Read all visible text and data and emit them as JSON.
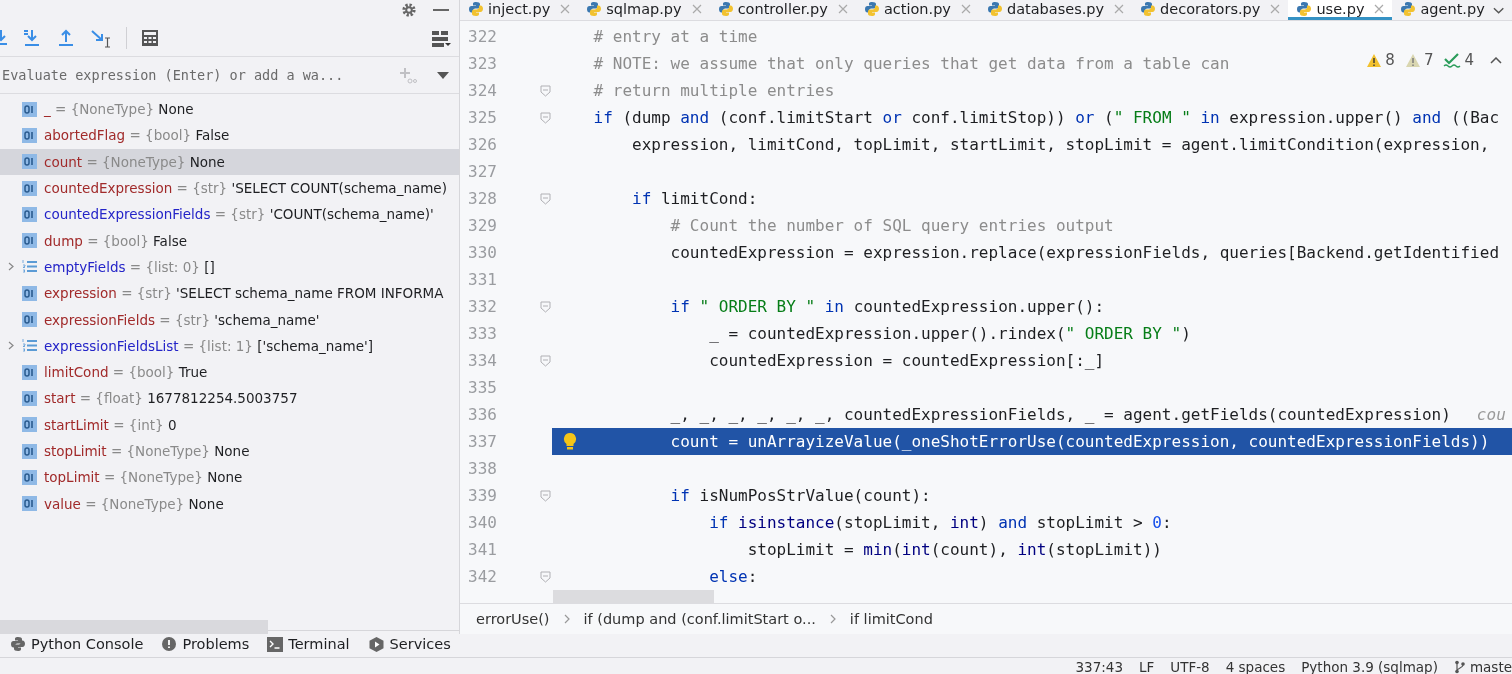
{
  "debugger": {
    "evaluate_field": {
      "placeholder": "Evaluate expression (Enter) or add a wa..."
    },
    "variables": [
      {
        "kind": "scalar",
        "name": "_",
        "annotation": "= {NoneType}",
        "value": "None",
        "color": "#a12a2a",
        "selected": false
      },
      {
        "kind": "scalar",
        "name": "abortedFlag",
        "annotation": "= {bool}",
        "value": "False",
        "color": "#a12a2a",
        "selected": false
      },
      {
        "kind": "scalar",
        "name": "count",
        "annotation": "= {NoneType}",
        "value": "None",
        "color": "#a12a2a",
        "selected": true
      },
      {
        "kind": "scalar",
        "name": "countedExpression",
        "annotation": "= {str}",
        "value": "'SELECT COUNT(schema_name)",
        "color": "#a12a2a",
        "selected": false
      },
      {
        "kind": "scalar",
        "name": "countedExpressionFields",
        "annotation": "= {str}",
        "value": "'COUNT(schema_name)'",
        "color": "#2424c8",
        "selected": false
      },
      {
        "kind": "scalar",
        "name": "dump",
        "annotation": "= {bool}",
        "value": "False",
        "color": "#a12a2a",
        "selected": false
      },
      {
        "kind": "list",
        "name": "emptyFields",
        "annotation": "= {list: 0}",
        "value": "[]",
        "color": "#2424c8",
        "selected": false
      },
      {
        "kind": "scalar",
        "name": "expression",
        "annotation": "= {str}",
        "value": "'SELECT schema_name FROM INFORMA",
        "color": "#a12a2a",
        "selected": false
      },
      {
        "kind": "scalar",
        "name": "expressionFields",
        "annotation": "= {str}",
        "value": "'schema_name'",
        "color": "#a12a2a",
        "selected": false
      },
      {
        "kind": "list",
        "name": "expressionFieldsList",
        "annotation": "= {list: 1}",
        "value": "['schema_name']",
        "color": "#2424c8",
        "selected": false
      },
      {
        "kind": "scalar",
        "name": "limitCond",
        "annotation": "= {bool}",
        "value": "True",
        "color": "#a12a2a",
        "selected": false
      },
      {
        "kind": "scalar",
        "name": "start",
        "annotation": "= {float}",
        "value": "1677812254.5003757",
        "color": "#a12a2a",
        "selected": false
      },
      {
        "kind": "scalar",
        "name": "startLimit",
        "annotation": "= {int}",
        "value": "0",
        "color": "#a12a2a",
        "selected": false
      },
      {
        "kind": "scalar",
        "name": "stopLimit",
        "annotation": "= {NoneType}",
        "value": "None",
        "color": "#a12a2a",
        "selected": false
      },
      {
        "kind": "scalar",
        "name": "topLimit",
        "annotation": "= {NoneType}",
        "value": "None",
        "color": "#a12a2a",
        "selected": false
      },
      {
        "kind": "scalar",
        "name": "value",
        "annotation": "= {NoneType}",
        "value": "None",
        "color": "#a12a2a",
        "selected": false
      }
    ]
  },
  "tabs": [
    {
      "label": "inject.py",
      "selected": false,
      "closable": true
    },
    {
      "label": "sqlmap.py",
      "selected": false,
      "closable": true
    },
    {
      "label": "controller.py",
      "selected": false,
      "closable": true
    },
    {
      "label": "action.py",
      "selected": false,
      "closable": true
    },
    {
      "label": "databases.py",
      "selected": false,
      "closable": true
    },
    {
      "label": "decorators.py",
      "selected": false,
      "closable": true
    },
    {
      "label": "use.py",
      "selected": true,
      "closable": true
    },
    {
      "label": "agent.py",
      "selected": false,
      "closable": false
    }
  ],
  "inspections": [
    {
      "kind": "warning",
      "count": "8"
    },
    {
      "kind": "weak-warning",
      "count": "7"
    },
    {
      "kind": "typo",
      "count": "4"
    }
  ],
  "editor": {
    "lines": [
      {
        "number": "322",
        "fold": false,
        "highlighted": false,
        "tokens": [
          {
            "kind": "comment",
            "text": "    # entry at a time"
          }
        ]
      },
      {
        "number": "323",
        "fold": false,
        "highlighted": false,
        "tokens": [
          {
            "kind": "comment",
            "text": "    # NOTE: we assume that only queries that get data from a table can"
          }
        ]
      },
      {
        "number": "324",
        "fold": true,
        "highlighted": false,
        "tokens": [
          {
            "kind": "comment",
            "text": "    # return multiple entries"
          }
        ]
      },
      {
        "number": "325",
        "fold": true,
        "highlighted": false,
        "tokens": [
          {
            "kind": "keyword",
            "text": "    if"
          },
          {
            "kind": "plain",
            "text": " (dump "
          },
          {
            "kind": "keyword",
            "text": "and"
          },
          {
            "kind": "plain",
            "text": " (conf.limitStart "
          },
          {
            "kind": "keyword",
            "text": "or"
          },
          {
            "kind": "plain",
            "text": " conf.limitStop)) "
          },
          {
            "kind": "keyword",
            "text": "or"
          },
          {
            "kind": "plain",
            "text": " ("
          },
          {
            "kind": "string",
            "text": "\" FROM \""
          },
          {
            "kind": "keyword",
            "text": " in"
          },
          {
            "kind": "plain",
            "text": " expression.upper() "
          },
          {
            "kind": "keyword",
            "text": "and"
          },
          {
            "kind": "plain",
            "text": " ((Bac"
          }
        ]
      },
      {
        "number": "326",
        "fold": false,
        "highlighted": false,
        "tokens": [
          {
            "kind": "plain",
            "text": "        expression, limitCond, topLimit, startLimit, stopLimit = agent.limitCondition(expression,"
          }
        ]
      },
      {
        "number": "327",
        "fold": false,
        "highlighted": false
      },
      {
        "number": "328",
        "fold": true,
        "highlighted": false,
        "tokens": [
          {
            "kind": "keyword",
            "text": "        if"
          },
          {
            "kind": "plain",
            "text": " limitCond:"
          }
        ]
      },
      {
        "number": "329",
        "fold": false,
        "highlighted": false,
        "tokens": [
          {
            "kind": "comment",
            "text": "            # Count the number of SQL query entries output"
          }
        ]
      },
      {
        "number": "330",
        "fold": false,
        "highlighted": false,
        "tokens": [
          {
            "kind": "plain",
            "text": "            countedExpression = expression.replace(expressionFields, queries[Backend.getIdentified"
          }
        ]
      },
      {
        "number": "331",
        "fold": false,
        "highlighted": false
      },
      {
        "number": "332",
        "fold": true,
        "highlighted": false,
        "tokens": [
          {
            "kind": "keyword",
            "text": "            if "
          },
          {
            "kind": "string",
            "text": "\" ORDER BY \""
          },
          {
            "kind": "keyword",
            "text": " in"
          },
          {
            "kind": "plain",
            "text": " countedExpression.upper():"
          }
        ]
      },
      {
        "number": "333",
        "fold": false,
        "highlighted": false,
        "tokens": [
          {
            "kind": "plain",
            "text": "                _ = countedExpression.upper().rindex("
          },
          {
            "kind": "string",
            "text": "\" ORDER BY \""
          },
          {
            "kind": "plain",
            "text": ")"
          }
        ]
      },
      {
        "number": "334",
        "fold": true,
        "highlighted": false,
        "tokens": [
          {
            "kind": "plain",
            "text": "                countedExpression = countedExpression[:_]"
          }
        ]
      },
      {
        "number": "335",
        "fold": false,
        "highlighted": false
      },
      {
        "number": "336",
        "fold": false,
        "highlighted": false,
        "tokens": [
          {
            "kind": "plain",
            "text": "            _, _, _, _, _, _, countedExpressionFields, _ = agent.getFields(countedExpression)"
          }
        ],
        "hint": "cou"
      },
      {
        "number": "337",
        "fold": false,
        "highlighted": true,
        "tokens": [
          {
            "kind": "plain",
            "text": "            count = unArrayizeValue(_oneShotErrorUse(countedExpression, countedExpressionFields))"
          }
        ]
      },
      {
        "number": "338",
        "fold": false,
        "highlighted": false
      },
      {
        "number": "339",
        "fold": true,
        "highlighted": false,
        "tokens": [
          {
            "kind": "keyword",
            "text": "            if"
          },
          {
            "kind": "plain",
            "text": " isNumPosStrValue(count):"
          }
        ]
      },
      {
        "number": "340",
        "fold": false,
        "highlighted": false,
        "tokens": [
          {
            "kind": "keyword",
            "text": "                if "
          },
          {
            "kind": "builtin",
            "text": "isinstance"
          },
          {
            "kind": "plain",
            "text": "(stopLimit, "
          },
          {
            "kind": "builtin",
            "text": "int"
          },
          {
            "kind": "plain",
            "text": ") "
          },
          {
            "kind": "keyword",
            "text": "and"
          },
          {
            "kind": "plain",
            "text": " stopLimit > "
          },
          {
            "kind": "number",
            "text": "0"
          },
          {
            "kind": "plain",
            "text": ":"
          }
        ]
      },
      {
        "number": "341",
        "fold": false,
        "highlighted": false,
        "tokens": [
          {
            "kind": "plain",
            "text": "                    stopLimit = "
          },
          {
            "kind": "builtin",
            "text": "min"
          },
          {
            "kind": "plain",
            "text": "("
          },
          {
            "kind": "builtin",
            "text": "int"
          },
          {
            "kind": "plain",
            "text": "(count), "
          },
          {
            "kind": "builtin",
            "text": "int"
          },
          {
            "kind": "plain",
            "text": "(stopLimit))"
          }
        ]
      },
      {
        "number": "342",
        "fold": true,
        "highlighted": false,
        "tokens": [
          {
            "kind": "keyword",
            "text": "                else"
          },
          {
            "kind": "plain",
            "text": ":"
          }
        ]
      }
    ]
  },
  "breadcrumbs": [
    "errorUse()",
    "if (dump and (conf.limitStart o...",
    "if limitCond"
  ],
  "tool_windows": [
    {
      "kind": "python",
      "label": "Python Console"
    },
    {
      "kind": "problems",
      "label": "Problems"
    },
    {
      "kind": "terminal",
      "label": "Terminal"
    },
    {
      "kind": "services",
      "label": "Services"
    }
  ],
  "status_bar": {
    "position": "337:43",
    "line_separator": "LF",
    "encoding": "UTF-8",
    "indent": "4 spaces",
    "interpreter": "Python 3.9 (sqlmap)",
    "branch": "maste"
  }
}
